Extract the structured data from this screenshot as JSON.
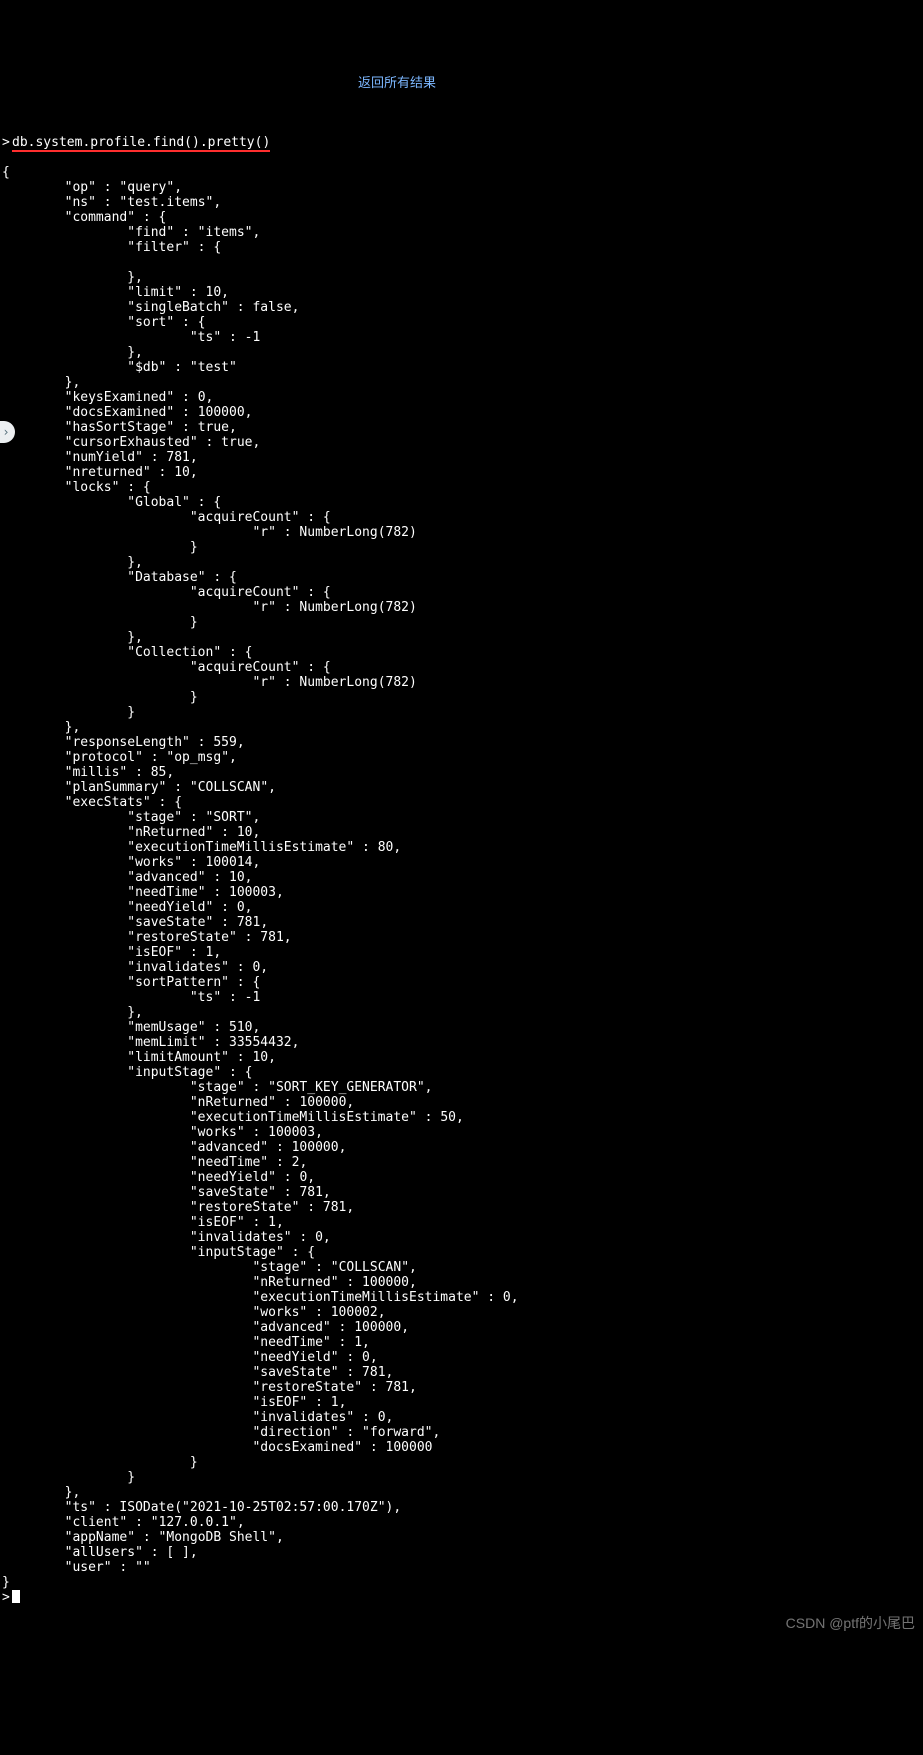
{
  "prompt_char": ">",
  "command": "db.system.profile.find().pretty()",
  "annotation": "返回所有结果",
  "watermark": "CSDN @ptf的小尾巴",
  "sidebar_chevron": "›",
  "output": {
    "op": "query",
    "ns": "test.items",
    "command": {
      "find": "items",
      "filter": {},
      "limit": 10,
      "singleBatch": false,
      "sort": {
        "ts": -1
      },
      "$db": "test"
    },
    "keysExamined": 0,
    "docsExamined": 100000,
    "hasSortStage": true,
    "cursorExhausted": true,
    "numYield": 781,
    "nreturned": 10,
    "locks": {
      "Global": {
        "acquireCount": {
          "r": "NumberLong(782)"
        }
      },
      "Database": {
        "acquireCount": {
          "r": "NumberLong(782)"
        }
      },
      "Collection": {
        "acquireCount": {
          "r": "NumberLong(782)"
        }
      }
    },
    "responseLength": 559,
    "protocol": "op_msg",
    "millis": 85,
    "planSummary": "COLLSCAN",
    "execStats": {
      "stage": "SORT",
      "nReturned": 10,
      "executionTimeMillisEstimate": 80,
      "works": 100014,
      "advanced": 10,
      "needTime": 100003,
      "needYield": 0,
      "saveState": 781,
      "restoreState": 781,
      "isEOF": 1,
      "invalidates": 0,
      "sortPattern": {
        "ts": -1
      },
      "memUsage": 510,
      "memLimit": 33554432,
      "limitAmount": 10,
      "inputStage": {
        "stage": "SORT_KEY_GENERATOR",
        "nReturned": 100000,
        "executionTimeMillisEstimate": 50,
        "works": 100003,
        "advanced": 100000,
        "needTime": 2,
        "needYield": 0,
        "saveState": 781,
        "restoreState": 781,
        "isEOF": 1,
        "invalidates": 0,
        "inputStage": {
          "stage": "COLLSCAN",
          "nReturned": 100000,
          "executionTimeMillisEstimate": 0,
          "works": 100002,
          "advanced": 100000,
          "needTime": 1,
          "needYield": 0,
          "saveState": 781,
          "restoreState": 781,
          "isEOF": 1,
          "invalidates": 0,
          "direction": "forward",
          "docsExamined": 100000
        }
      }
    },
    "ts": "ISODate(\"2021-10-25T02:57:00.170Z\")",
    "client": "127.0.0.1",
    "appName": "MongoDB Shell",
    "allUsers": "[ ]",
    "user": ""
  }
}
